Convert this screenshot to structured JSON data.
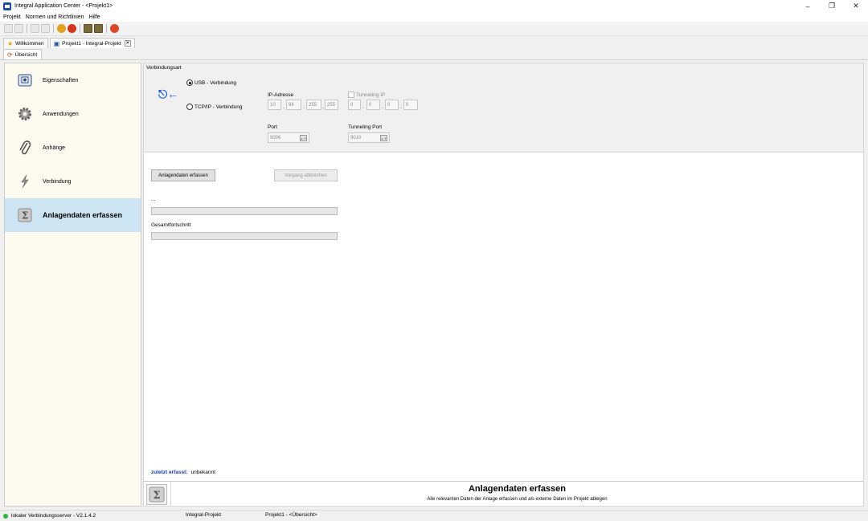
{
  "window": {
    "title": "Integral Application Center - <Projekt1>"
  },
  "menu": [
    "Projekt",
    "Normen und Richtlinien",
    "Hilfe"
  ],
  "doc_tabs": [
    {
      "label": "Willkommen",
      "icon": "star-icon"
    },
    {
      "label": "Projekt1 - Integral-Projekt",
      "icon": "project-icon",
      "closable": true
    }
  ],
  "view_tab": {
    "label": "Übersicht",
    "icon": "overview-icon"
  },
  "sidebar": {
    "items": [
      {
        "label": "Eigenschaften",
        "icon": "properties-icon"
      },
      {
        "label": "Anwendungen",
        "icon": "gear-icon"
      },
      {
        "label": "Anhänge",
        "icon": "paperclip-icon"
      },
      {
        "label": "Verbindung",
        "icon": "lightning-icon"
      },
      {
        "label": "Anlagendaten erfassen",
        "icon": "sigma-icon",
        "active": true
      }
    ]
  },
  "connection": {
    "group_title": "Verbindungsart",
    "usb_label": "USB - Verbindung",
    "tcp_label": "TCP/IP - Verbindung",
    "selected": "usb",
    "ip_label": "IP-Adresse",
    "ip": [
      "10",
      "94",
      "255",
      "255"
    ],
    "tunneling_ip_label": "Tunneling IP",
    "tunneling_ip": [
      "0",
      "0",
      "0",
      "0"
    ],
    "port_label": "Port",
    "port": "9006",
    "tunneling_port_label": "Tunneling Port",
    "tunneling_port": "9010"
  },
  "actions": {
    "capture_button": "Anlagendaten erfassen",
    "cancel_button": "Vorgang abbrechen"
  },
  "progress": {
    "step_label": "...",
    "step_value": 0,
    "total_label": "Gesamtfortschritt",
    "total_value": 0
  },
  "last": {
    "key": "zuletzt erfasst:",
    "value": "unbekannt"
  },
  "banner": {
    "title": "Anlagendaten erfassen",
    "subtitle": "Alle relevanten Daten der Anlage erfassen und als externe Daten im Projekt ablegen"
  },
  "status": {
    "server": "lokaler Verbindungsserver - V2.1.4.2",
    "project": "Integral-Projekt",
    "view": "Projekt1 - <Übersicht>",
    "server_color": "#2db83d"
  }
}
